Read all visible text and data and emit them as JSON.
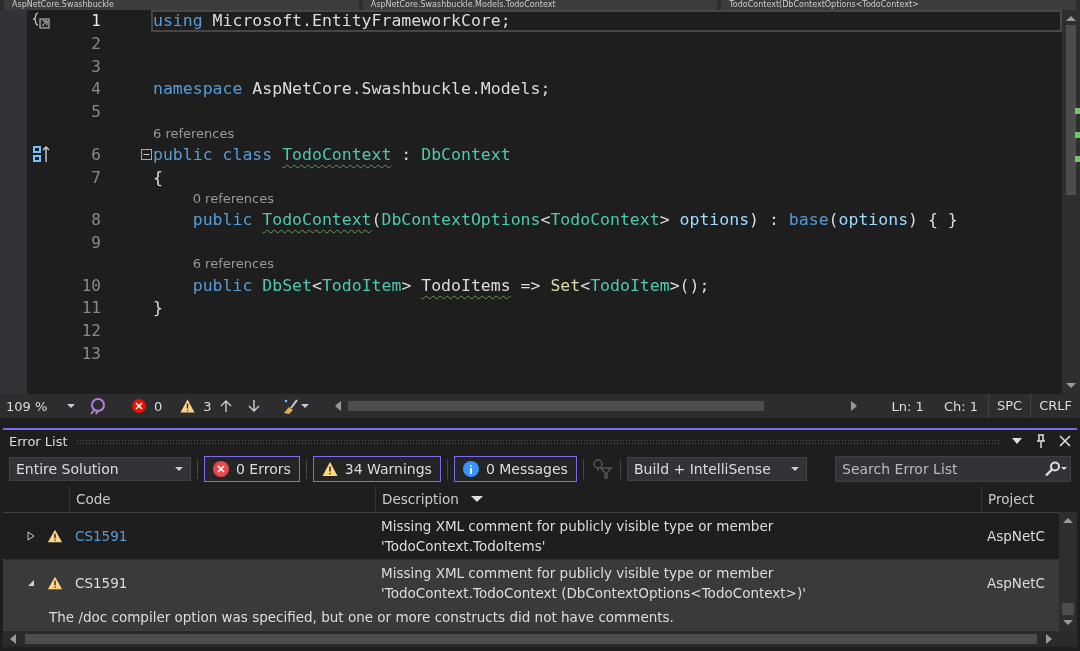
{
  "nav_bar": {
    "dropdowns": [
      "AspNetCore.Swashbuckle",
      "AspNetCore.Swashbuckle.Models.TodoContext",
      "TodoContext(DbContextOptions<TodoContext>"
    ]
  },
  "editor": {
    "lines": [
      {
        "number": "1",
        "current": true,
        "gutter_icon": {
          "kind": "braces"
        },
        "tokens": [
          {
            "text": "using",
            "kind": "keyword"
          },
          {
            "text": " Microsoft.EntityFrameworkCore;",
            "kind": "plain"
          }
        ]
      },
      {
        "number": "2"
      },
      {
        "number": "3"
      },
      {
        "number": "4",
        "tokens": [
          {
            "text": "namespace",
            "kind": "keyword"
          },
          {
            "text": " AspNetCore.Swashbuckle.Models;",
            "kind": "plain"
          }
        ]
      },
      {
        "number": "5"
      },
      {
        "number": "6",
        "codelens": "6 references",
        "gutter_icon": {
          "kind": "class"
        },
        "collapsible": true,
        "tokens": [
          {
            "text": "public class ",
            "kind": "keyword"
          },
          {
            "text": "TodoContext",
            "kind": "type",
            "squiggle": true
          },
          {
            "text": " : ",
            "kind": "plain"
          },
          {
            "text": "DbContext",
            "kind": "type"
          }
        ]
      },
      {
        "number": "7",
        "tokens": [
          {
            "text": "{",
            "kind": "plain"
          }
        ]
      },
      {
        "number": "8",
        "codelens": "0 references",
        "tokens": [
          {
            "text": "    public ",
            "kind": "keyword"
          },
          {
            "text": "TodoContext",
            "kind": "type",
            "squiggle": true
          },
          {
            "text": "(",
            "kind": "plain"
          },
          {
            "text": "DbContextOptions",
            "kind": "type"
          },
          {
            "text": "<",
            "kind": "plain"
          },
          {
            "text": "TodoContext",
            "kind": "type"
          },
          {
            "text": "> ",
            "kind": "plain"
          },
          {
            "text": "options",
            "kind": "param"
          },
          {
            "text": ") : ",
            "kind": "plain"
          },
          {
            "text": "base",
            "kind": "keyword"
          },
          {
            "text": "(",
            "kind": "plain"
          },
          {
            "text": "options",
            "kind": "param"
          },
          {
            "text": ") { }",
            "kind": "plain"
          }
        ]
      },
      {
        "number": "9"
      },
      {
        "number": "10",
        "codelens": "6 references",
        "tokens": [
          {
            "text": "    public ",
            "kind": "keyword"
          },
          {
            "text": "DbSet",
            "kind": "type"
          },
          {
            "text": "<",
            "kind": "plain"
          },
          {
            "text": "TodoItem",
            "kind": "type"
          },
          {
            "text": "> ",
            "kind": "plain"
          },
          {
            "text": "TodoItems",
            "kind": "plain",
            "squiggle": true
          },
          {
            "text": " => ",
            "kind": "plain"
          },
          {
            "text": "Set",
            "kind": "method"
          },
          {
            "text": "<",
            "kind": "plain"
          },
          {
            "text": "TodoItem",
            "kind": "type"
          },
          {
            "text": ">();",
            "kind": "plain"
          }
        ]
      },
      {
        "number": "11",
        "tokens": [
          {
            "text": "}",
            "kind": "plain"
          }
        ]
      },
      {
        "number": "12"
      },
      {
        "number": "13"
      }
    ]
  },
  "status_bar": {
    "zoom": "109 %",
    "errors": "0",
    "warnings": "3",
    "line": "Ln: 1",
    "column": "Ch: 1",
    "whitespace": "SPC",
    "line_endings": "CRLF"
  },
  "error_list": {
    "title": "Error List",
    "scope": "Entire Solution",
    "filters": [
      {
        "kind": "error",
        "label": "0 Errors",
        "selected": true
      },
      {
        "kind": "warning",
        "label": "34 Warnings",
        "selected": true
      },
      {
        "kind": "info",
        "label": "0 Messages",
        "selected": true
      }
    ],
    "source": "Build + IntelliSense",
    "search": {
      "placeholder": "Search Error List"
    },
    "columns": [
      "Code",
      "Description",
      "Project"
    ],
    "rows": [
      {
        "expanded": false,
        "selected": false,
        "code": "CS1591",
        "description": "Missing XML comment for publicly visible type or member 'TodoContext.TodoItems'",
        "project": "AspNetC"
      },
      {
        "expanded": true,
        "selected": true,
        "code": "CS1591",
        "description": "Missing XML comment for publicly visible type or member 'TodoContext.TodoContext (DbContextOptions<TodoContext>)'",
        "project": "AspNetC",
        "detail": "The /doc compiler option was specified, but one or more constructs did not have comments."
      }
    ]
  }
}
